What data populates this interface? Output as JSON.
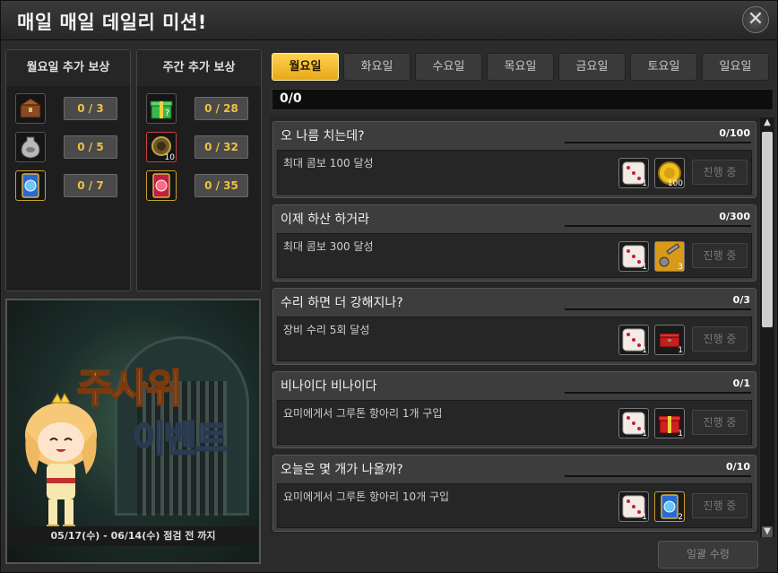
{
  "window": {
    "title": "매일 매일 데일리 미션!",
    "close_label": "✕"
  },
  "monday_bonus": {
    "header": "월요일 추가 보상",
    "rewards": [
      {
        "icon": "chest-icon",
        "count": "0 / 3"
      },
      {
        "icon": "vase-icon",
        "count": "0 / 5"
      },
      {
        "icon": "blue-card-icon",
        "count": "0 / 7"
      }
    ]
  },
  "weekly_bonus": {
    "header": "주간 추가 보상",
    "rewards": [
      {
        "icon": "green-gift-icon",
        "count": "0 / 28",
        "qty": ""
      },
      {
        "icon": "coin-icon",
        "count": "0 / 32",
        "qty": "10"
      },
      {
        "icon": "red-card-icon",
        "count": "0 / 35",
        "qty": ""
      }
    ]
  },
  "banner": {
    "title_line1": "주사위",
    "title_line2": "이벤트",
    "period": "05/17(수) - 06/14(수) 점검 전 까지"
  },
  "tabs": [
    "월요일",
    "화요일",
    "수요일",
    "목요일",
    "금요일",
    "토요일",
    "일요일"
  ],
  "active_tab": 0,
  "overall_progress": "0/0",
  "missions": [
    {
      "title": "오 나름 치는데?",
      "progress": "0/100",
      "desc": "최대 콤보 100 달성",
      "items": [
        {
          "icon": "dice-icon",
          "qty": "1"
        },
        {
          "icon": "gold-coin-icon",
          "qty": "100"
        }
      ],
      "status": "진행 중"
    },
    {
      "title": "이제 하산 하거라",
      "progress": "0/300",
      "desc": "최대 콤보 300 달성",
      "items": [
        {
          "icon": "dice-icon",
          "qty": "1"
        },
        {
          "icon": "key-icon",
          "qty": "3"
        }
      ],
      "status": "진행 중"
    },
    {
      "title": "수리 하면 더 강해지나?",
      "progress": "0/3",
      "desc": "장비 수리 5회 달성",
      "items": [
        {
          "icon": "dice-icon",
          "qty": "1"
        },
        {
          "icon": "red-box-icon",
          "qty": "1"
        }
      ],
      "status": "진행 중"
    },
    {
      "title": "비나이다 비나이다",
      "progress": "0/1",
      "desc": "요미에게서 그루톤 항아리 1개 구입",
      "items": [
        {
          "icon": "dice-icon",
          "qty": "1"
        },
        {
          "icon": "red-gift-icon",
          "qty": "1"
        }
      ],
      "status": "진행 중"
    },
    {
      "title": "오늘은 몇 개가 나올까?",
      "progress": "0/10",
      "desc": "요미에게서 그루톤 항아리 10개 구입",
      "items": [
        {
          "icon": "dice-icon",
          "qty": "1"
        },
        {
          "icon": "blue-card-icon",
          "qty": "2"
        }
      ],
      "status": "진행 중"
    }
  ],
  "claim_all_label": "일괄 수령",
  "colors": {
    "accent": "#f0c040",
    "active_tab": "#ffd24d"
  }
}
